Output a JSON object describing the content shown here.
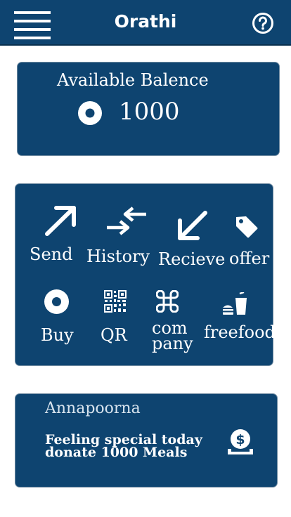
{
  "app": {
    "title": "Orathi"
  },
  "balance": {
    "label": "Available Balence",
    "value": "1000"
  },
  "actions": [
    {
      "id": "send",
      "label": "Send",
      "icon": "arrow-up-right-icon"
    },
    {
      "id": "history",
      "label": "History",
      "icon": "swap-arrows-icon"
    },
    {
      "id": "receive",
      "label": "Recieve",
      "icon": "arrow-down-left-icon"
    },
    {
      "id": "offer",
      "label": "offer",
      "icon": "tag-icon"
    },
    {
      "id": "buy",
      "label": "Buy",
      "icon": "coin-icon"
    },
    {
      "id": "qr",
      "label": "QR",
      "icon": "qr-code-icon"
    },
    {
      "id": "company",
      "label_lines": [
        "com",
        "pany"
      ],
      "icon": "command-icon"
    },
    {
      "id": "freefood",
      "label": "freefood",
      "icon": "fastfood-icon"
    }
  ],
  "promo": {
    "title": "Annapoorna",
    "lines": [
      "Feeling special today",
      "donate 1000 Meals"
    ],
    "icon": "donate-money-icon"
  },
  "colors": {
    "primary": "#0e4470",
    "text": "#ffffff",
    "background": "#ffffff"
  }
}
